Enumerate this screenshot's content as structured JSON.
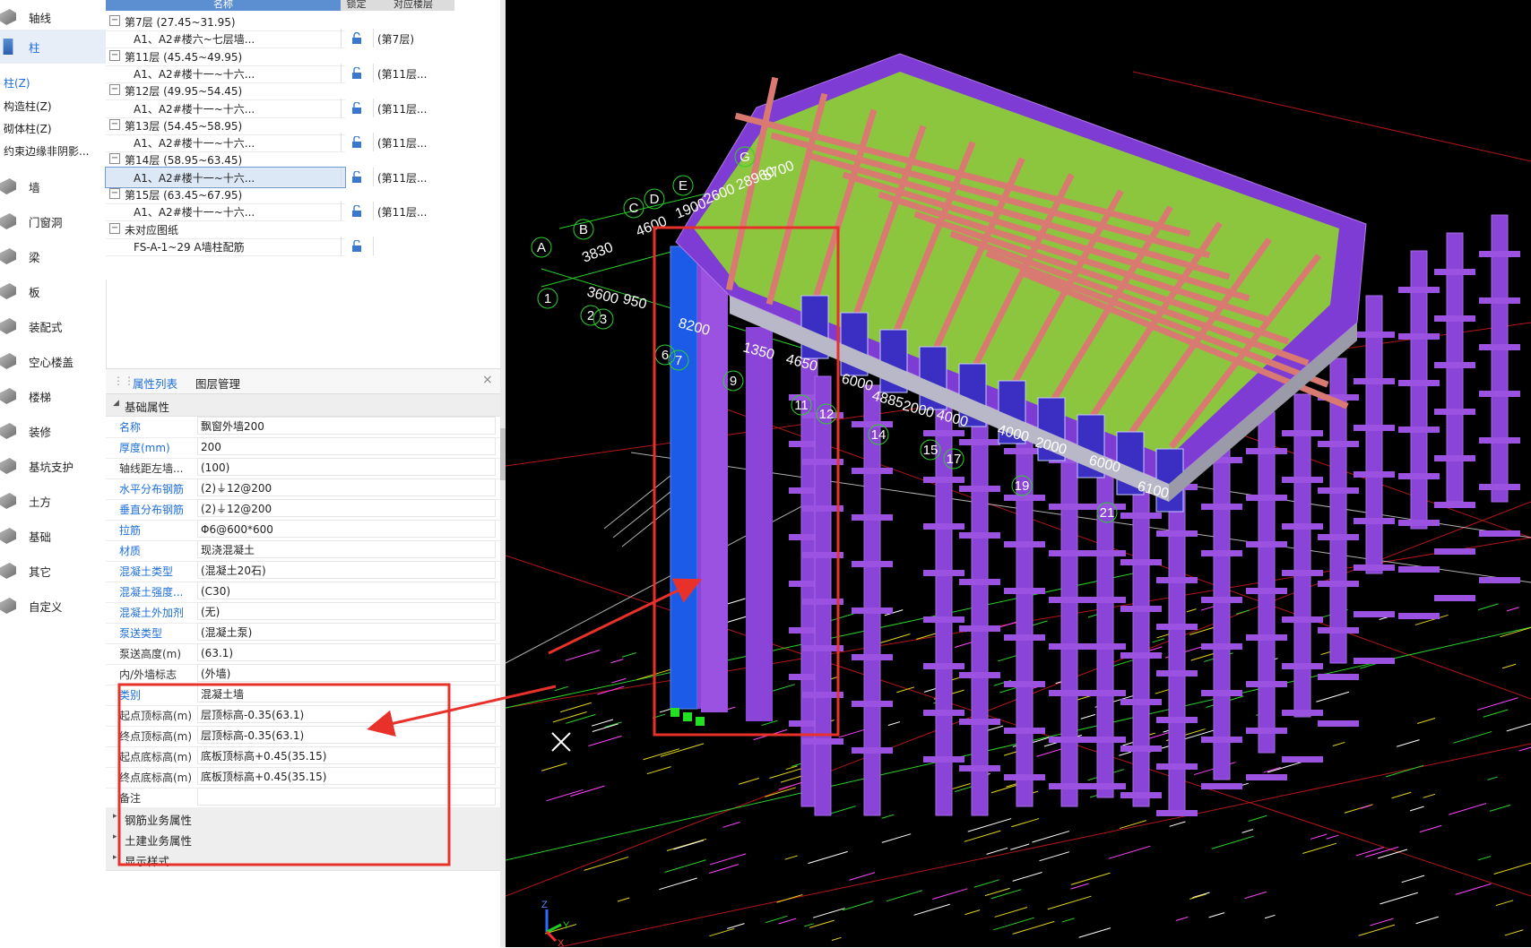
{
  "sidebar": {
    "items": [
      {
        "label": "轴线",
        "icon": "grid-axis-icon"
      },
      {
        "label": "柱",
        "icon": "column-icon"
      },
      {
        "label": "墙",
        "icon": "wall-icon"
      },
      {
        "label": "门窗洞",
        "icon": "door-window-icon"
      },
      {
        "label": "梁",
        "icon": "beam-icon"
      },
      {
        "label": "板",
        "icon": "slab-icon"
      },
      {
        "label": "装配式",
        "icon": "prefab-icon"
      },
      {
        "label": "空心楼盖",
        "icon": "hollow-floor-icon"
      },
      {
        "label": "楼梯",
        "icon": "stair-icon"
      },
      {
        "label": "装修",
        "icon": "decoration-icon"
      },
      {
        "label": "基坑支护",
        "icon": "pit-support-icon"
      },
      {
        "label": "土方",
        "icon": "earthwork-icon"
      },
      {
        "label": "基础",
        "icon": "foundation-icon"
      },
      {
        "label": "其它",
        "icon": "other-icon"
      },
      {
        "label": "自定义",
        "icon": "custom-icon"
      }
    ],
    "column_sub": [
      "柱(Z)",
      "构造柱(Z)",
      "砌体柱(Z)",
      "约束边缘非阴影..."
    ]
  },
  "tree": {
    "header": {
      "name": "名称",
      "lock": "锁定",
      "floor": "对应楼层"
    },
    "rows": [
      {
        "type": "group",
        "label": "第7层 (27.45~31.95)"
      },
      {
        "type": "child",
        "label": "A1、A2#楼六~七层墙...",
        "locked": false,
        "floor": "(第7层)"
      },
      {
        "type": "group",
        "label": "第11层 (45.45~49.95)"
      },
      {
        "type": "child",
        "label": "A1、A2#楼十一~十六...",
        "locked": true,
        "floor": "(第11层..."
      },
      {
        "type": "group",
        "label": "第12层 (49.95~54.45)"
      },
      {
        "type": "child",
        "label": "A1、A2#楼十一~十六...",
        "locked": true,
        "floor": "(第11层..."
      },
      {
        "type": "group",
        "label": "第13层 (54.45~58.95)"
      },
      {
        "type": "child",
        "label": "A1、A2#楼十一~十六...",
        "locked": true,
        "floor": "(第11层..."
      },
      {
        "type": "group",
        "label": "第14层 (58.95~63.45)"
      },
      {
        "type": "child",
        "label": "A1、A2#楼十一~十六...",
        "locked": true,
        "floor": "(第11层...",
        "selected": true
      },
      {
        "type": "group",
        "label": "第15层 (63.45~67.95)"
      },
      {
        "type": "child",
        "label": "A1、A2#楼十一~十六...",
        "locked": true,
        "floor": "(第11层..."
      },
      {
        "type": "group",
        "label": "未对应图纸"
      },
      {
        "type": "child",
        "label": "FS-A-1~29 A墙柱配筋",
        "locked": true,
        "floor": ""
      }
    ]
  },
  "props": {
    "tabs": [
      "属性列表",
      "图层管理"
    ],
    "close": "×",
    "sections": {
      "basic": "基础属性",
      "rebar": "钢筋业务属性",
      "civil": "土建业务属性",
      "display": "显示样式"
    },
    "rows": [
      {
        "name": "名称",
        "value": "飘窗外墙200",
        "blue": true
      },
      {
        "name": "厚度(mm)",
        "value": "200",
        "blue": true
      },
      {
        "name": "轴线距左墙...",
        "value": "(100)",
        "blue": false
      },
      {
        "name": "水平分布钢筋",
        "value": "(2)⏚12@200",
        "blue": true
      },
      {
        "name": "垂直分布钢筋",
        "value": "(2)⏚12@200",
        "blue": true
      },
      {
        "name": "拉筋",
        "value": "Φ6@600*600",
        "blue": true
      },
      {
        "name": "材质",
        "value": "现浇混凝土",
        "blue": true
      },
      {
        "name": "混凝土类型",
        "value": "(混凝土20石)",
        "blue": true
      },
      {
        "name": "混凝土强度...",
        "value": "(C30)",
        "blue": true
      },
      {
        "name": "混凝土外加剂",
        "value": "(无)",
        "blue": true
      },
      {
        "name": "泵送类型",
        "value": "(混凝土泵)",
        "blue": true
      },
      {
        "name": "泵送高度(m)",
        "value": "(63.1)",
        "blue": false
      },
      {
        "name": "内/外墙标志",
        "value": "(外墙)",
        "blue": false
      },
      {
        "name": "类别",
        "value": "混凝土墙",
        "blue": true
      },
      {
        "name": "起点顶标高(m)",
        "value": "层顶标高-0.35(63.1)",
        "blue": false
      },
      {
        "name": "终点顶标高(m)",
        "value": "层顶标高-0.35(63.1)",
        "blue": false
      },
      {
        "name": "起点底标高(m)",
        "value": "底板顶标高+0.45(35.15)",
        "blue": false
      },
      {
        "name": "终点底标高(m)",
        "value": "底板顶标高+0.45(35.15)",
        "blue": false
      },
      {
        "name": "备注",
        "value": "",
        "blue": false
      }
    ]
  },
  "viewport": {
    "axis_bubbles": [
      "A",
      "B",
      "C",
      "D",
      "E",
      "G",
      "1",
      "2",
      "3",
      "6",
      "7",
      "9",
      "11",
      "12",
      "14",
      "15",
      "17",
      "19",
      "21"
    ],
    "dimensions": [
      "3830",
      "4600",
      "1900",
      "2600",
      "28960",
      "5700",
      "3600",
      "950",
      "8200",
      "1350",
      "4650",
      "6000",
      "4885",
      "2000",
      "4000",
      "4000",
      "2000",
      "6000",
      "6100"
    ],
    "axes": {
      "z": "Z",
      "y": "Y",
      "x": "X"
    }
  },
  "colors": {
    "accent": "#1e6fd9",
    "annotation": "#e8312a",
    "wall_purple": "#8a44d8",
    "selected_wall": "#1b5be8",
    "slab_green": "#8cc63f",
    "beam_pink": "#d97a72",
    "axis_line": "#2bd12b",
    "grid_red": "#d71d1d"
  }
}
